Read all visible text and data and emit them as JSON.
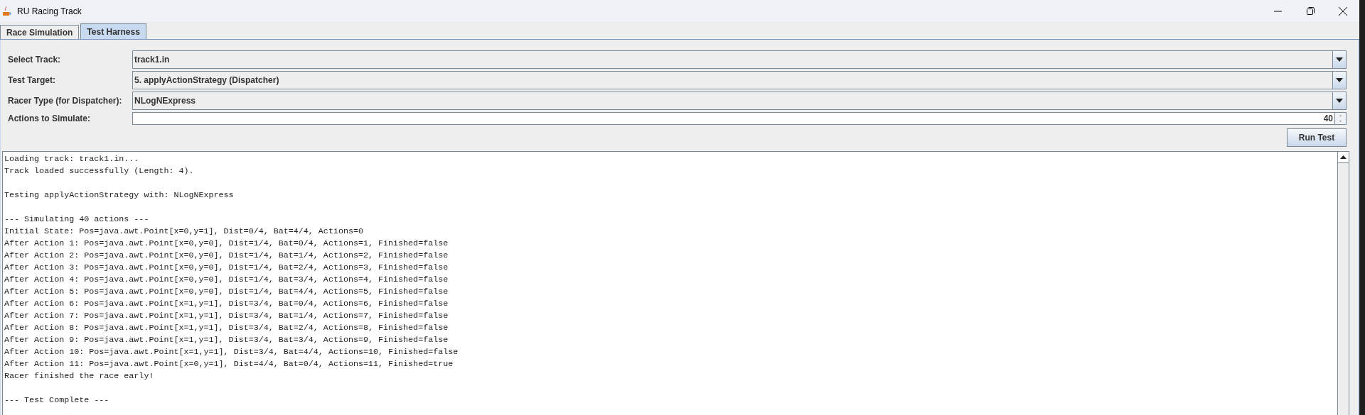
{
  "window": {
    "title": "RU Racing Track"
  },
  "tabs": [
    {
      "label": "Race Simulation",
      "selected": false
    },
    {
      "label": "Test Harness",
      "selected": true
    }
  ],
  "form": [
    {
      "kind": "dropdown",
      "label": "Select Track:",
      "value": "track1.in"
    },
    {
      "kind": "dropdown",
      "label": "Test Target:",
      "value": "5. applyActionStrategy (Dispatcher)"
    },
    {
      "kind": "dropdown",
      "label": "Racer Type (for Dispatcher):",
      "value": "NLogNExpress"
    },
    {
      "kind": "spinner",
      "label": "Actions to Simulate:",
      "value": "40"
    }
  ],
  "run_button": "Run Test",
  "log_blocks": [
    [
      "Loading track: track1.in...",
      "Track loaded successfully (Length: 4)."
    ],
    [
      "Testing applyActionStrategy with: NLogNExpress"
    ],
    [
      "--- Simulating 40 actions ---",
      "Initial State: Pos=java.awt.Point[x=0,y=1], Dist=0/4, Bat=4/4, Actions=0",
      "After Action 1: Pos=java.awt.Point[x=0,y=0], Dist=1/4, Bat=0/4, Actions=1, Finished=false",
      "After Action 2: Pos=java.awt.Point[x=0,y=0], Dist=1/4, Bat=1/4, Actions=2, Finished=false",
      "After Action 3: Pos=java.awt.Point[x=0,y=0], Dist=1/4, Bat=2/4, Actions=3, Finished=false",
      "After Action 4: Pos=java.awt.Point[x=0,y=0], Dist=1/4, Bat=3/4, Actions=4, Finished=false",
      "After Action 5: Pos=java.awt.Point[x=0,y=0], Dist=1/4, Bat=4/4, Actions=5, Finished=false",
      "After Action 6: Pos=java.awt.Point[x=1,y=1], Dist=3/4, Bat=0/4, Actions=6, Finished=false",
      "After Action 7: Pos=java.awt.Point[x=1,y=1], Dist=3/4, Bat=1/4, Actions=7, Finished=false",
      "After Action 8: Pos=java.awt.Point[x=1,y=1], Dist=3/4, Bat=2/4, Actions=8, Finished=false",
      "After Action 9: Pos=java.awt.Point[x=1,y=1], Dist=3/4, Bat=3/4, Actions=9, Finished=false",
      "After Action 10: Pos=java.awt.Point[x=1,y=1], Dist=3/4, Bat=4/4, Actions=10, Finished=false",
      "After Action 11: Pos=java.awt.Point[x=0,y=1], Dist=4/4, Bat=0/4, Actions=11, Finished=true",
      "Racer finished the race early!"
    ],
    [
      "--- Test Complete ---"
    ]
  ]
}
